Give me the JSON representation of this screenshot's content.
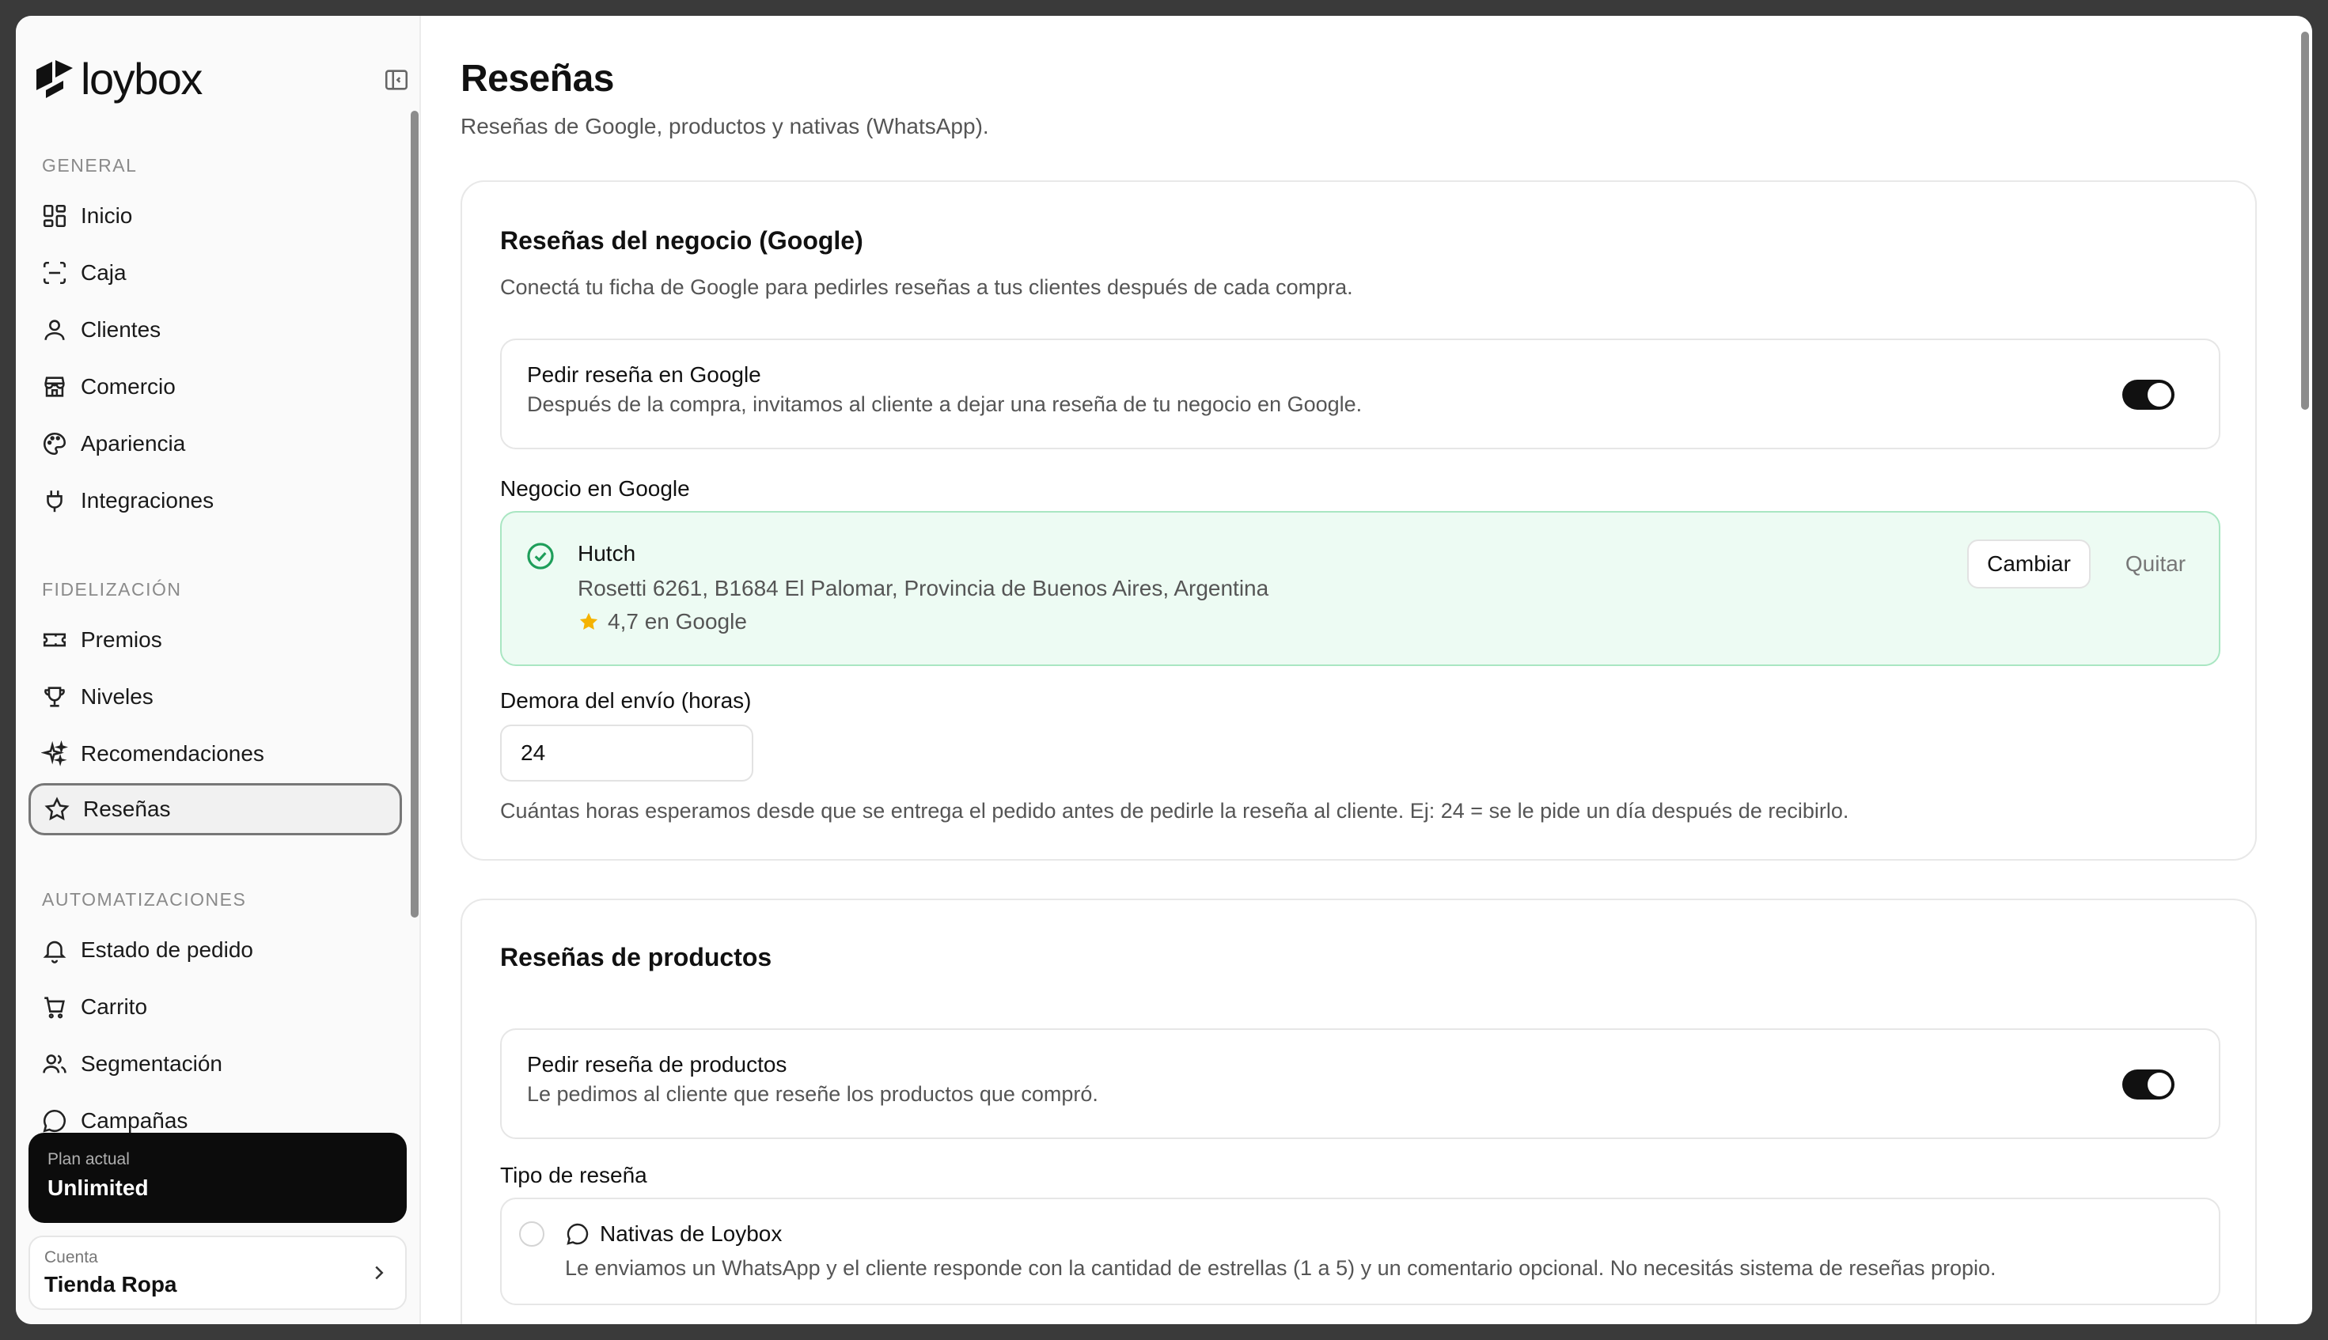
{
  "brand": {
    "name": "loybox"
  },
  "sidebar": {
    "sections": [
      {
        "label": "GENERAL",
        "items": [
          "Inicio",
          "Caja",
          "Clientes",
          "Comercio",
          "Apariencia",
          "Integraciones"
        ]
      },
      {
        "label": "FIDELIZACIÓN",
        "items": [
          "Premios",
          "Niveles",
          "Recomendaciones",
          "Reseñas"
        ]
      },
      {
        "label": "AUTOMATIZACIONES",
        "items": [
          "Estado de pedido",
          "Carrito",
          "Segmentación",
          "Campañas"
        ]
      }
    ],
    "active_item": "Reseñas",
    "plan": {
      "label": "Plan actual",
      "value": "Unlimited"
    },
    "account": {
      "label": "Cuenta",
      "value": "Tienda Ropa"
    }
  },
  "main": {
    "title": "Reseñas",
    "subtitle": "Reseñas de Google, productos y nativas (WhatsApp).",
    "google_card": {
      "title": "Reseñas del negocio (Google)",
      "description": "Conectá tu ficha de Google para pedirles reseñas a tus clientes después de cada compra.",
      "toggle_row": {
        "title": "Pedir reseña en Google",
        "description": "Después de la compra, invitamos al cliente a dejar una reseña de tu negocio en Google.",
        "enabled": true
      },
      "business_label": "Negocio en Google",
      "business": {
        "name": "Hutch",
        "address": "Rosetti 6261, B1684 El Palomar, Provincia de Buenos Aires, Argentina",
        "rating_text": "4,7 en Google",
        "change_label": "Cambiar",
        "remove_label": "Quitar"
      },
      "delay_label": "Demora del envío (horas)",
      "delay_value": "24",
      "delay_help": "Cuántas horas esperamos desde que se entrega el pedido antes de pedirle la reseña al cliente. Ej: 24 = se le pide un día después de recibirlo."
    },
    "products_card": {
      "title": "Reseñas de productos",
      "toggle_row": {
        "title": "Pedir reseña de productos",
        "description": "Le pedimos al cliente que reseñe los productos que compró.",
        "enabled": true
      },
      "type_label": "Tipo de reseña",
      "option": {
        "title": "Nativas de Loybox",
        "description": "Le enviamos un WhatsApp y el cliente responde con la cantidad de estrellas (1 a 5) y un comentario opcional. No necesitás sistema de reseñas propio."
      }
    }
  },
  "colors": {
    "accent": "#111111",
    "success_bg": "#edfbf3",
    "success_border": "#a9e6c2",
    "success_icon": "#1e9e5a",
    "star": "#f5b301"
  }
}
